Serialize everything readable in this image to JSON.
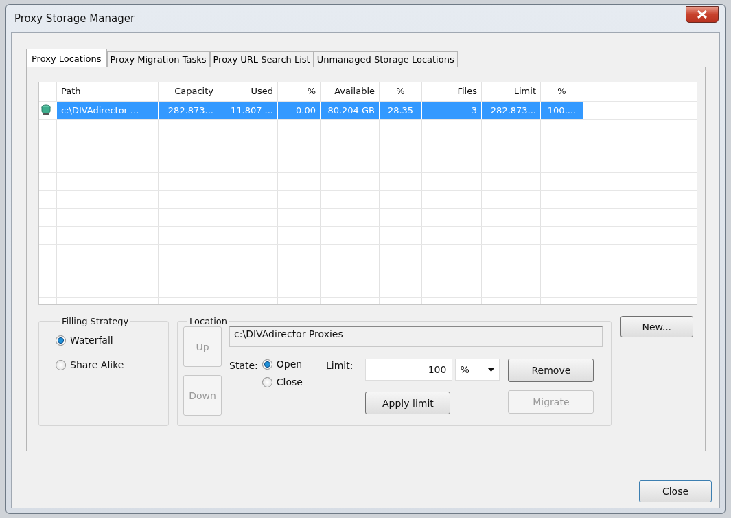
{
  "window": {
    "title": "Proxy Storage Manager"
  },
  "tabs": [
    {
      "label": "Proxy Locations",
      "selected": true
    },
    {
      "label": "Proxy Migration Tasks",
      "selected": false
    },
    {
      "label": "Proxy URL Search List",
      "selected": false
    },
    {
      "label": "Unmanaged Storage Locations",
      "selected": false
    }
  ],
  "table": {
    "columns": [
      "Path",
      "Capacity",
      "Used",
      "%",
      "Available",
      "%",
      "Files",
      "Limit",
      "%"
    ],
    "rows": [
      {
        "selected": true,
        "cells": [
          "c:\\DIVAdirector ...",
          "282.873...",
          "11.807 ...",
          "0.00",
          "80.204 GB",
          "28.35",
          "3",
          "282.873...",
          "100...."
        ]
      }
    ]
  },
  "filling_strategy": {
    "title": "Filling Strategy",
    "options": [
      {
        "label": "Waterfall",
        "selected": true
      },
      {
        "label": "Share Alike",
        "selected": false
      }
    ]
  },
  "location": {
    "title": "Location",
    "path": "c:\\DIVAdirector Proxies",
    "up_button": {
      "label": "Up",
      "disabled": true
    },
    "down_button": {
      "label": "Down",
      "disabled": true
    },
    "state_label": "State:",
    "state_options": [
      {
        "label": "Open",
        "selected": true
      },
      {
        "label": "Close",
        "selected": false
      }
    ],
    "limit_label": "Limit:",
    "limit_value": "100",
    "limit_unit": "%",
    "remove_button": {
      "label": "Remove",
      "disabled": false
    },
    "apply_button": {
      "label": "Apply limit",
      "disabled": false
    },
    "migrate_button": {
      "label": "Migrate",
      "disabled": true
    }
  },
  "new_button": {
    "label": "New...",
    "disabled": false
  },
  "close_button": {
    "label": "Close",
    "disabled": false
  }
}
